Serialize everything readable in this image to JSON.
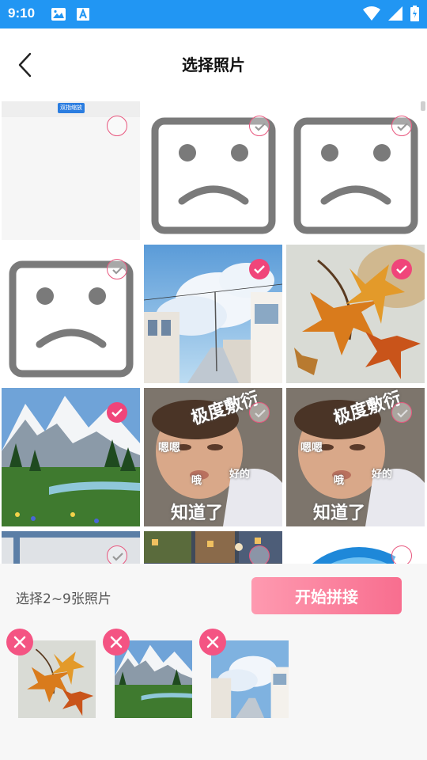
{
  "status_bar": {
    "time": "9:10",
    "icons": [
      "image-icon",
      "font-icon",
      "wifi-icon",
      "signal-icon",
      "battery-icon"
    ]
  },
  "header": {
    "title": "选择照片",
    "back_icon": "chevron-left-icon"
  },
  "grid": {
    "items": [
      {
        "kind": "screenshot",
        "checked": false,
        "badge": "双指缩放"
      },
      {
        "kind": "sad-face",
        "checked": false
      },
      {
        "kind": "sad-face",
        "checked": false
      },
      {
        "kind": "sad-face",
        "checked": false
      },
      {
        "kind": "anime-street",
        "checked": true
      },
      {
        "kind": "autumn-leaves",
        "checked": true
      },
      {
        "kind": "mountain-lake",
        "checked": true
      },
      {
        "kind": "baby-meme",
        "checked": false,
        "texts": [
          "极度敷衍",
          "嗯嗯",
          "哦",
          "好的",
          "知道了"
        ]
      },
      {
        "kind": "baby-meme",
        "checked": false,
        "texts": [
          "极度敷衍",
          "嗯嗯",
          "哦",
          "好的",
          "知道了"
        ]
      },
      {
        "kind": "partial-window",
        "checked": false
      },
      {
        "kind": "pixel-town",
        "checked": false
      },
      {
        "kind": "blue-circle",
        "checked": false
      }
    ]
  },
  "bottom": {
    "hint": "选择2~9张照片",
    "start_button": "开始拼接",
    "selected": [
      {
        "kind": "autumn-leaves"
      },
      {
        "kind": "mountain-lake"
      },
      {
        "kind": "anime-street"
      }
    ]
  },
  "colors": {
    "status_bar": "#2196f3",
    "accent": "#f0457a",
    "button_gradient_start": "#fe9ab0",
    "button_gradient_end": "#f86e8f"
  }
}
